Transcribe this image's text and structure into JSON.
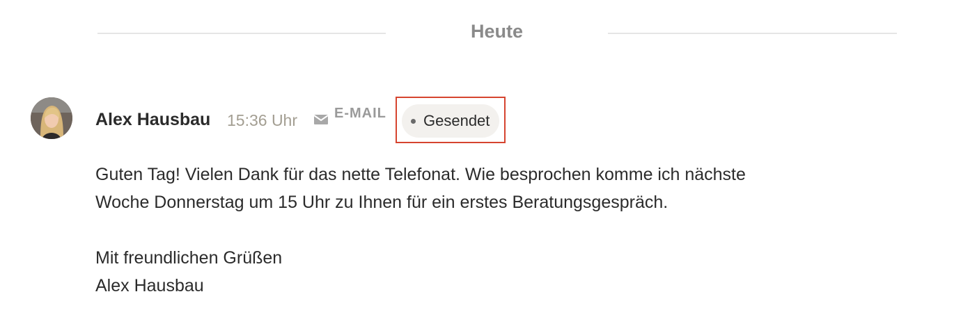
{
  "day_divider": {
    "label": "Heute"
  },
  "message": {
    "sender_name": "Alex Hausbau",
    "time": "15:36 Uhr",
    "channel_icon": "envelope-icon",
    "channel_label": "E-MAIL",
    "status_label": "Gesendet",
    "highlight_color": "#d6442f",
    "body_lines": [
      "Guten Tag! Vielen Dank für das nette Telefonat. Wie besprochen komme ich nächste",
      "Woche Donnerstag um 15 Uhr zu Ihnen für ein erstes Beratungsgespräch.",
      "Mit freundlichen Grüßen",
      "Alex Hausbau"
    ]
  }
}
